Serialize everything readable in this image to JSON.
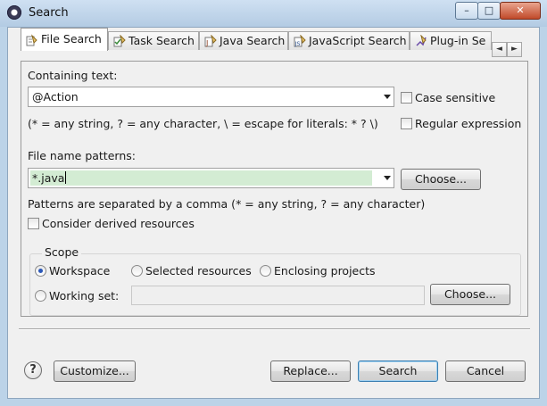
{
  "window": {
    "title": "Search",
    "minimize_glyph": "–",
    "maximize_glyph": "□",
    "close_glyph": "✕"
  },
  "tabs": [
    {
      "label": "File Search",
      "icon": "file-search-icon",
      "active": true
    },
    {
      "label": "Task Search",
      "icon": "task-search-icon",
      "active": false
    },
    {
      "label": "Java Search",
      "icon": "java-search-icon",
      "active": false
    },
    {
      "label": "JavaScript Search",
      "icon": "javascript-search-icon",
      "active": false
    },
    {
      "label": "Plug-in Se",
      "icon": "plugin-search-icon",
      "active": false
    }
  ],
  "tab_scroll": {
    "left": "◄",
    "right": "►"
  },
  "containing": {
    "label": "Containing text:",
    "value": "@Action",
    "hint": "(* = any string, ? = any character, \\ = escape for literals: * ? \\)",
    "case_sensitive_label": "Case sensitive",
    "case_sensitive_checked": false,
    "regex_label": "Regular expression",
    "regex_checked": false
  },
  "file_patterns": {
    "label": "File name patterns:",
    "value": "*.java",
    "choose_label": "Choose...",
    "hint": "Patterns are separated by a comma (* = any string, ? = any character)",
    "derived_label": "Consider derived resources",
    "derived_checked": false
  },
  "scope": {
    "label": "Scope",
    "workspace_label": "Workspace",
    "selected_label": "Selected resources",
    "enclosing_label": "Enclosing projects",
    "working_set_label": "Working set:",
    "working_set_value": "",
    "choose_label": "Choose...",
    "selected_option": "Workspace"
  },
  "footer": {
    "help_glyph": "?",
    "customize_label": "Customize...",
    "replace_label": "Replace...",
    "search_label": "Search",
    "cancel_label": "Cancel"
  },
  "colors": {
    "selection_highlight": "#d3ecd3",
    "default_button_border": "#3c7fb1",
    "title_bar": "#bcd3e8"
  }
}
